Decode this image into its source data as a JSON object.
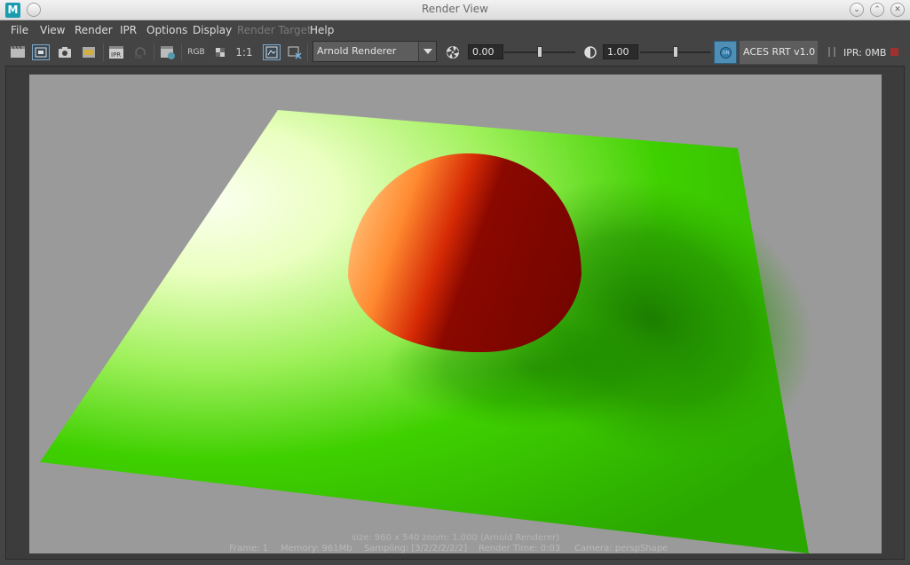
{
  "window": {
    "title": "Render View",
    "logo_letter": "M"
  },
  "menu": [
    {
      "label": "File",
      "enabled": true
    },
    {
      "label": "View",
      "enabled": true
    },
    {
      "label": "Render",
      "enabled": true
    },
    {
      "label": "IPR",
      "enabled": true
    },
    {
      "label": "Options",
      "enabled": true
    },
    {
      "label": "Display",
      "enabled": true
    },
    {
      "label": "Render Target",
      "enabled": false
    },
    {
      "label": "Help",
      "enabled": true
    }
  ],
  "toolbar": {
    "rgb_label": "RGB",
    "ratio_label": "1:1",
    "ipr_label": "IPR",
    "renderer": "Arnold Renderer",
    "exposure_value": "0.00",
    "gamma_value": "1.00",
    "view_transform": "ACES RRT v1.0",
    "ipr_status": "IPR: 0MB",
    "aces_toggle_text": "ON"
  },
  "render_info": {
    "line1": "size: 960 x 540 zoom: 1.000     (Arnold Renderer)",
    "frame": "Frame: 1",
    "memory": "Memory: 961Mb",
    "sampling": "Sampling: [3/2/2/2/2/2]",
    "render_time": "Render Time: 0:03",
    "camera": "Camera: perspShape"
  },
  "colors": {
    "plane_bright": "#f6ffd8",
    "plane_green": "#2fc000",
    "sphere_light": "#ffb060",
    "sphere_red": "#d02000",
    "sphere_dark": "#7a0500",
    "background": "#9a9a9a"
  }
}
